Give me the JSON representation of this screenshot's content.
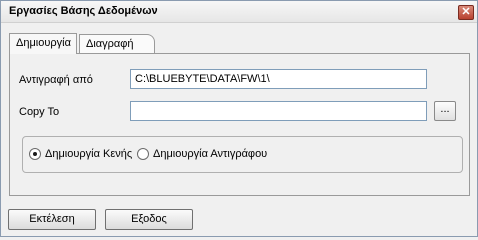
{
  "window": {
    "title": "Εργασίες Βάσης Δεδομένων",
    "close_glyph": "✕"
  },
  "tabs": [
    {
      "label": "Δημιουργία",
      "active": true
    },
    {
      "label": "Διαγραφή",
      "active": false
    }
  ],
  "form": {
    "copy_from_label": "Αντιγραφή από",
    "copy_from_value": "C:\\BLUEBYTE\\DATA\\FW\\1\\",
    "copy_to_label": "Copy To",
    "copy_to_value": "",
    "browse_label": "..."
  },
  "options": {
    "create_empty_label": "Δημιουργία Κενής",
    "create_copy_label": "Δημιουργία Αντιγράφου",
    "selected": "create_empty"
  },
  "buttons": {
    "execute_label": "Εκτέλεση",
    "exit_label": "Εξοδος"
  }
}
